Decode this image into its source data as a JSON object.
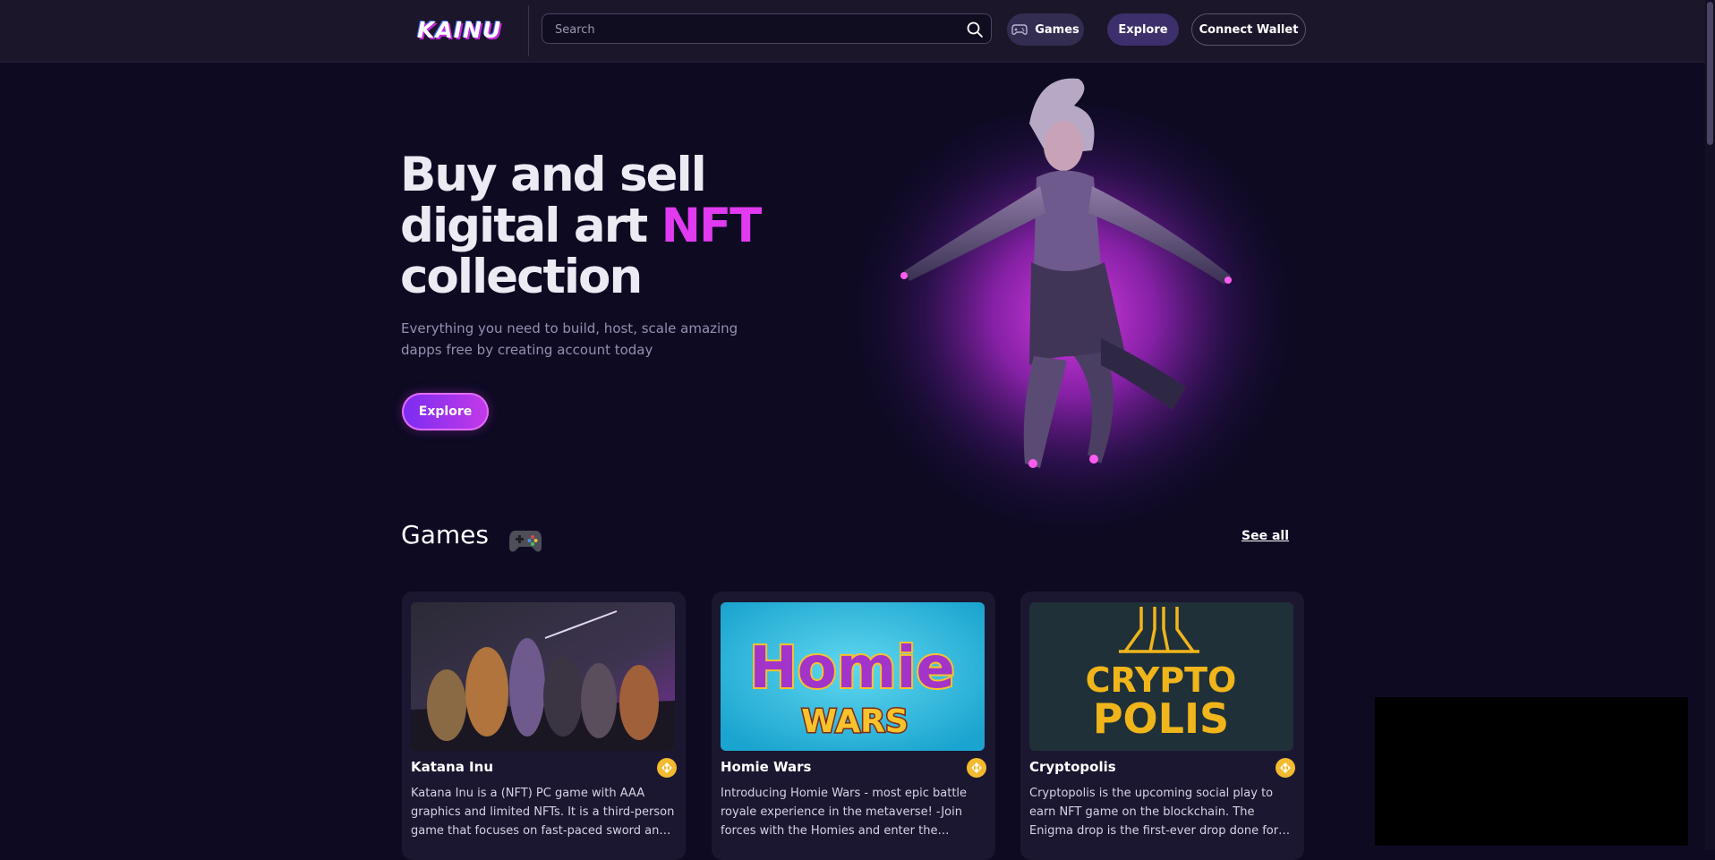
{
  "nav": {
    "logo": "KAINU",
    "search_placeholder": "Search",
    "games_label": "Games",
    "explore_label": "Explore",
    "wallet_label": "Connect Wallet"
  },
  "hero": {
    "title_line1": "Buy and sell",
    "title_line2_pre": "digital art ",
    "title_accent": "NFT",
    "title_line3": "collection",
    "subtitle": "Everything you need to build, host, scale amazing dapps free by creating account today",
    "cta_label": "Explore"
  },
  "games_section": {
    "title": "Games",
    "see_all_label": "See all",
    "cards": [
      {
        "title": "Katana Inu",
        "description": "Katana Inu is a (NFT) PC game with AAA graphics and limited NFTs. It is a third-person game that focuses on fast-paced sword and gun combat."
      },
      {
        "title": "Homie Wars",
        "description": "Introducing Homie Wars - most epic battle royale experience in the metaverse! -Join forces with the Homies and enter the battlefield."
      },
      {
        "title": "Cryptopolis",
        "description": "Cryptopolis is the upcoming social play to earn NFT game on the blockchain. The Enigma drop is the first-ever drop done for investors."
      }
    ],
    "thumb_texts": {
      "homie_line1": "Homie",
      "homie_line2": "WARS",
      "crypto_line1": "CRYPTO",
      "crypto_line2": "POLIS"
    }
  },
  "colors": {
    "background": "#0d0a22",
    "navbar": "#1b1629",
    "accent": "#e13af0",
    "card": "#1b1730",
    "chain_badge": "#f3ba2f"
  },
  "icons": [
    "search-icon",
    "gamepad-icon",
    "binance-coin-icon"
  ]
}
